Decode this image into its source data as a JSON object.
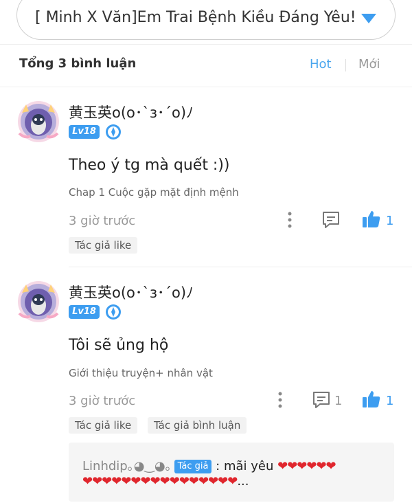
{
  "story_selector": {
    "title": "[ Minh X Văn]Em Trai Bệnh Kiều Đáng Yêu!",
    "arrow_icon": "dropdown-triangle-icon",
    "arrow_color": "#3d9df0"
  },
  "comments_header": {
    "total": "Tổng 3 bình luận",
    "sort_hot": "Hot",
    "sort_new": "Mới",
    "active_color": "#4aa6ee"
  },
  "comments": [
    {
      "username": "黄玉英o(o･`з･´o)ﾉ",
      "level": "Lv18",
      "text": "Theo ý tg mà quết :))",
      "chapter": "Chap 1 Cuộc gặp mặt định mệnh",
      "time": "3 giờ trước",
      "replies": "",
      "likes": "1",
      "tags": [
        "Tác giả like"
      ]
    },
    {
      "username": "黄玉英o(o･`з･´o)ﾉ",
      "level": "Lv18",
      "text": "Tôi sẽ ủng hộ",
      "chapter": "Giới thiệu truyện+ nhân vật",
      "time": "3 giờ trước",
      "replies": "1",
      "likes": "1",
      "tags": [
        "Tác giả like",
        "Tác giả bình luận"
      ],
      "reply_preview": {
        "user": "Linhdip｡◕‿◕｡",
        "badge": "Tác giả",
        "prefix": " : mãi yêu ",
        "hearts_line1": "❤❤❤❤❤❤",
        "hearts_line2": "❤❤❤❤❤❤❤❤❤❤❤❤❤❤❤❤",
        "ellipsis": "..."
      }
    }
  ]
}
